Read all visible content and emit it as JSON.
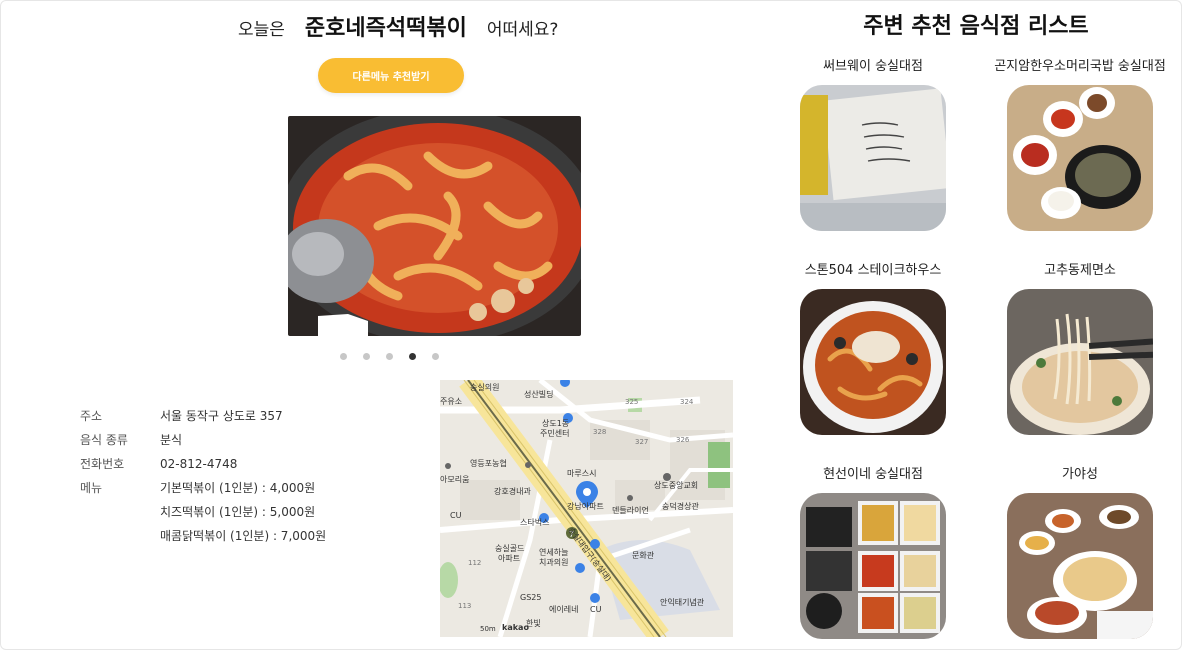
{
  "headline": {
    "prefix": "오늘은",
    "restaurant": "준호네즉석떡볶이",
    "suffix": "어떠세요?"
  },
  "recommend_button": "다른메뉴 추천받기",
  "carousel": {
    "count": 5,
    "active_index": 3
  },
  "info": {
    "labels": {
      "address": "주소",
      "category": "음식 종류",
      "phone": "전화번호",
      "menu": "메뉴"
    },
    "address": "서울 동작구 상도로 357",
    "category": "분식",
    "phone": "02-812-4748",
    "menu": [
      "기본떡볶이 (1인분) : 4,000원",
      "치즈떡볶이 (1인분) : 5,000원",
      "매콤닭떡볶이 (1인분) : 7,000원"
    ]
  },
  "map": {
    "labels": {
      "l1": "숭실의원",
      "l2": "성산빌딩",
      "l3": "주유소",
      "l4": "상도1동",
      "l5": "주민센터",
      "l6": "영등포농협",
      "l7": "마루스시",
      "l8": "아모리움",
      "l9": "강호경내과",
      "l10": "상도중앙교회",
      "l11": "강남아파트",
      "l12": "덴들라이언",
      "l13": "숭덕경상관",
      "l14": "스타벅스",
      "l15": "숭실골드",
      "l16": "아파트",
      "l17": "연세하늘",
      "l18": "치과의원",
      "l19": "문화관",
      "l20": "GS25",
      "l21": "에이레네",
      "l22": "안익태기념관",
      "l23": "CU",
      "l24": "CU",
      "l25": "kakao",
      "l26": "50m",
      "l27": "숭실대입구(숭실대)",
      "l28": "325",
      "l29": "324",
      "l30": "328",
      "l31": "327",
      "l32": "326",
      "l33": "112",
      "l34": "113",
      "l35": "한빛"
    }
  },
  "nearby": {
    "title": "주변 추천 음식점 리스트",
    "items": [
      {
        "name": "써브웨이 숭실대점"
      },
      {
        "name": "곤지암한우소머리국밥 숭실대점"
      },
      {
        "name": "스톤504 스테이크하우스"
      },
      {
        "name": "고추동제면소"
      },
      {
        "name": "현선이네 숭실대점"
      },
      {
        "name": "가야성"
      }
    ]
  },
  "colors": {
    "accent": "#f9bd33",
    "active_dot": "#333333",
    "inactive_dot": "#c7c7c7"
  }
}
